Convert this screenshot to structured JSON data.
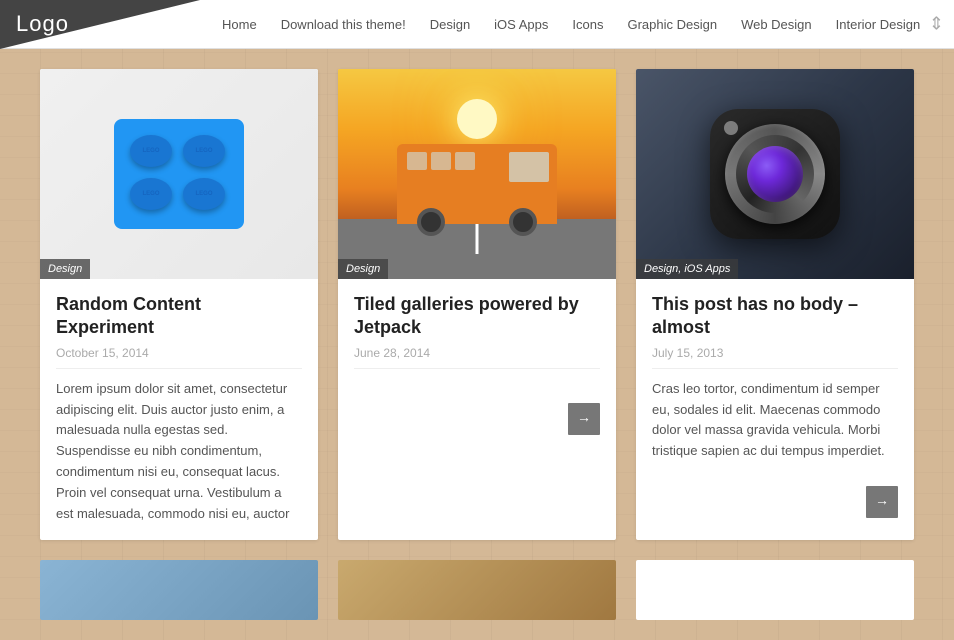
{
  "header": {
    "logo": "Logo",
    "nav": [
      {
        "label": "Home",
        "id": "home"
      },
      {
        "label": "Download this theme!",
        "id": "download"
      },
      {
        "label": "Design",
        "id": "design"
      },
      {
        "label": "iOS Apps",
        "id": "ios-apps"
      },
      {
        "label": "Icons",
        "id": "icons"
      },
      {
        "label": "Graphic Design",
        "id": "graphic-design"
      },
      {
        "label": "Web Design",
        "id": "web-design"
      },
      {
        "label": "Interior Design",
        "id": "interior-design"
      }
    ]
  },
  "cards": [
    {
      "tag": "Design",
      "title": "Random Content Experiment",
      "date": "October 15, 2014",
      "excerpt": "Lorem ipsum dolor sit amet, consectetur adipiscing elit. Duis auctor justo enim, a malesuada nulla egestas sed. Suspendisse eu nibh condimentum, condimentum nisi eu, consequat lacus. Proin vel consequat urna. Vestibulum a est malesuada, commodo nisi eu, auctor",
      "has_arrow": false
    },
    {
      "tag": "Design",
      "title": "Tiled galleries powered by Jetpack",
      "date": "June 28, 2014",
      "excerpt": "",
      "has_arrow": true,
      "arrow_label": "→"
    },
    {
      "tag": "Design, iOS Apps",
      "title": "This post has no body – almost",
      "date": "July 15, 2013",
      "excerpt": "Cras leo tortor, condimentum id semper eu, sodales id elit. Maecenas commodo dolor vel massa gravida vehicula. Morbi tristique sapien ac dui tempus imperdiet.",
      "has_arrow": true,
      "arrow_label": "→"
    }
  ]
}
